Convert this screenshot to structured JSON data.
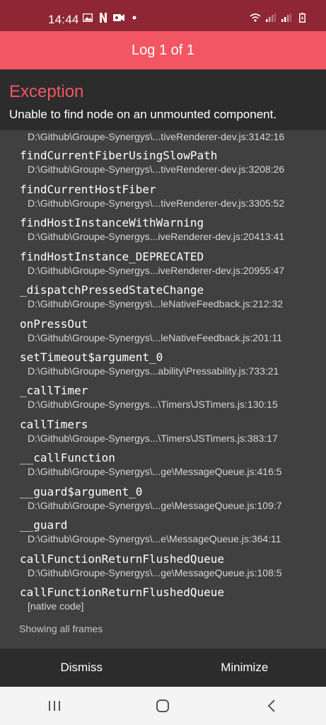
{
  "status_bar": {
    "time": "14:44",
    "left_icons": [
      "image-icon",
      "netflix-icon",
      "video-icon",
      "dot-icon"
    ],
    "right_icons": [
      "wifi-icon",
      "signal-icon",
      "signal-icon",
      "battery-icon"
    ]
  },
  "header": {
    "title": "Log 1 of 1"
  },
  "exception": {
    "title": "Exception",
    "message": "Unable to find node on an unmounted component."
  },
  "stack": {
    "first_file": "D:\\Github\\Groupe-Synergys\\...tiveRenderer-dev.js:3142:16",
    "frames": [
      {
        "fn": "findCurrentFiberUsingSlowPath",
        "file": "D:\\Github\\Groupe-Synergys\\...tiveRenderer-dev.js:3208:26"
      },
      {
        "fn": "findCurrentHostFiber",
        "file": "D:\\Github\\Groupe-Synergys\\...tiveRenderer-dev.js:3305:52"
      },
      {
        "fn": "findHostInstanceWithWarning",
        "file": "D:\\Github\\Groupe-Synergys...iveRenderer-dev.js:20413:41"
      },
      {
        "fn": "findHostInstance_DEPRECATED",
        "file": "D:\\Github\\Groupe-Synergys...iveRenderer-dev.js:20955:47"
      },
      {
        "fn": "_dispatchPressedStateChange",
        "file": "D:\\Github\\Groupe-Synergys\\...leNativeFeedback.js:212:32"
      },
      {
        "fn": "onPressOut",
        "file": "D:\\Github\\Groupe-Synergys\\...leNativeFeedback.js:201:11"
      },
      {
        "fn": "setTimeout$argument_0",
        "file": "D:\\Github\\Groupe-Synergys...ability\\Pressability.js:733:21"
      },
      {
        "fn": "_callTimer",
        "file": "D:\\Github\\Groupe-Synergys...\\Timers\\JSTimers.js:130:15"
      },
      {
        "fn": "callTimers",
        "file": "D:\\Github\\Groupe-Synergys...\\Timers\\JSTimers.js:383:17"
      },
      {
        "fn": "__callFunction",
        "file": "D:\\Github\\Groupe-Synergys\\...ge\\MessageQueue.js:416:5"
      },
      {
        "fn": "__guard$argument_0",
        "file": "D:\\Github\\Groupe-Synergys\\...ge\\MessageQueue.js:109:7"
      },
      {
        "fn": "__guard",
        "file": "D:\\Github\\Groupe-Synergys\\...e\\MessageQueue.js:364:11"
      },
      {
        "fn": "callFunctionReturnFlushedQueue",
        "file": "D:\\Github\\Groupe-Synergys\\...ge\\MessageQueue.js:108:5"
      },
      {
        "fn": "callFunctionReturnFlushedQueue",
        "file": "[native code]"
      }
    ],
    "showing_label": "Showing all frames"
  },
  "actions": {
    "dismiss": "Dismiss",
    "minimize": "Minimize"
  },
  "colors": {
    "status_bar": "#8f2633",
    "header": "#f25663",
    "exception_title": "#f25663",
    "stack_bg": "#404040",
    "panel_bg": "#2c2c2c",
    "navbar_bg": "#f4f4f4"
  },
  "navbar": {
    "buttons": [
      "recents-icon",
      "home-icon",
      "back-icon"
    ]
  }
}
